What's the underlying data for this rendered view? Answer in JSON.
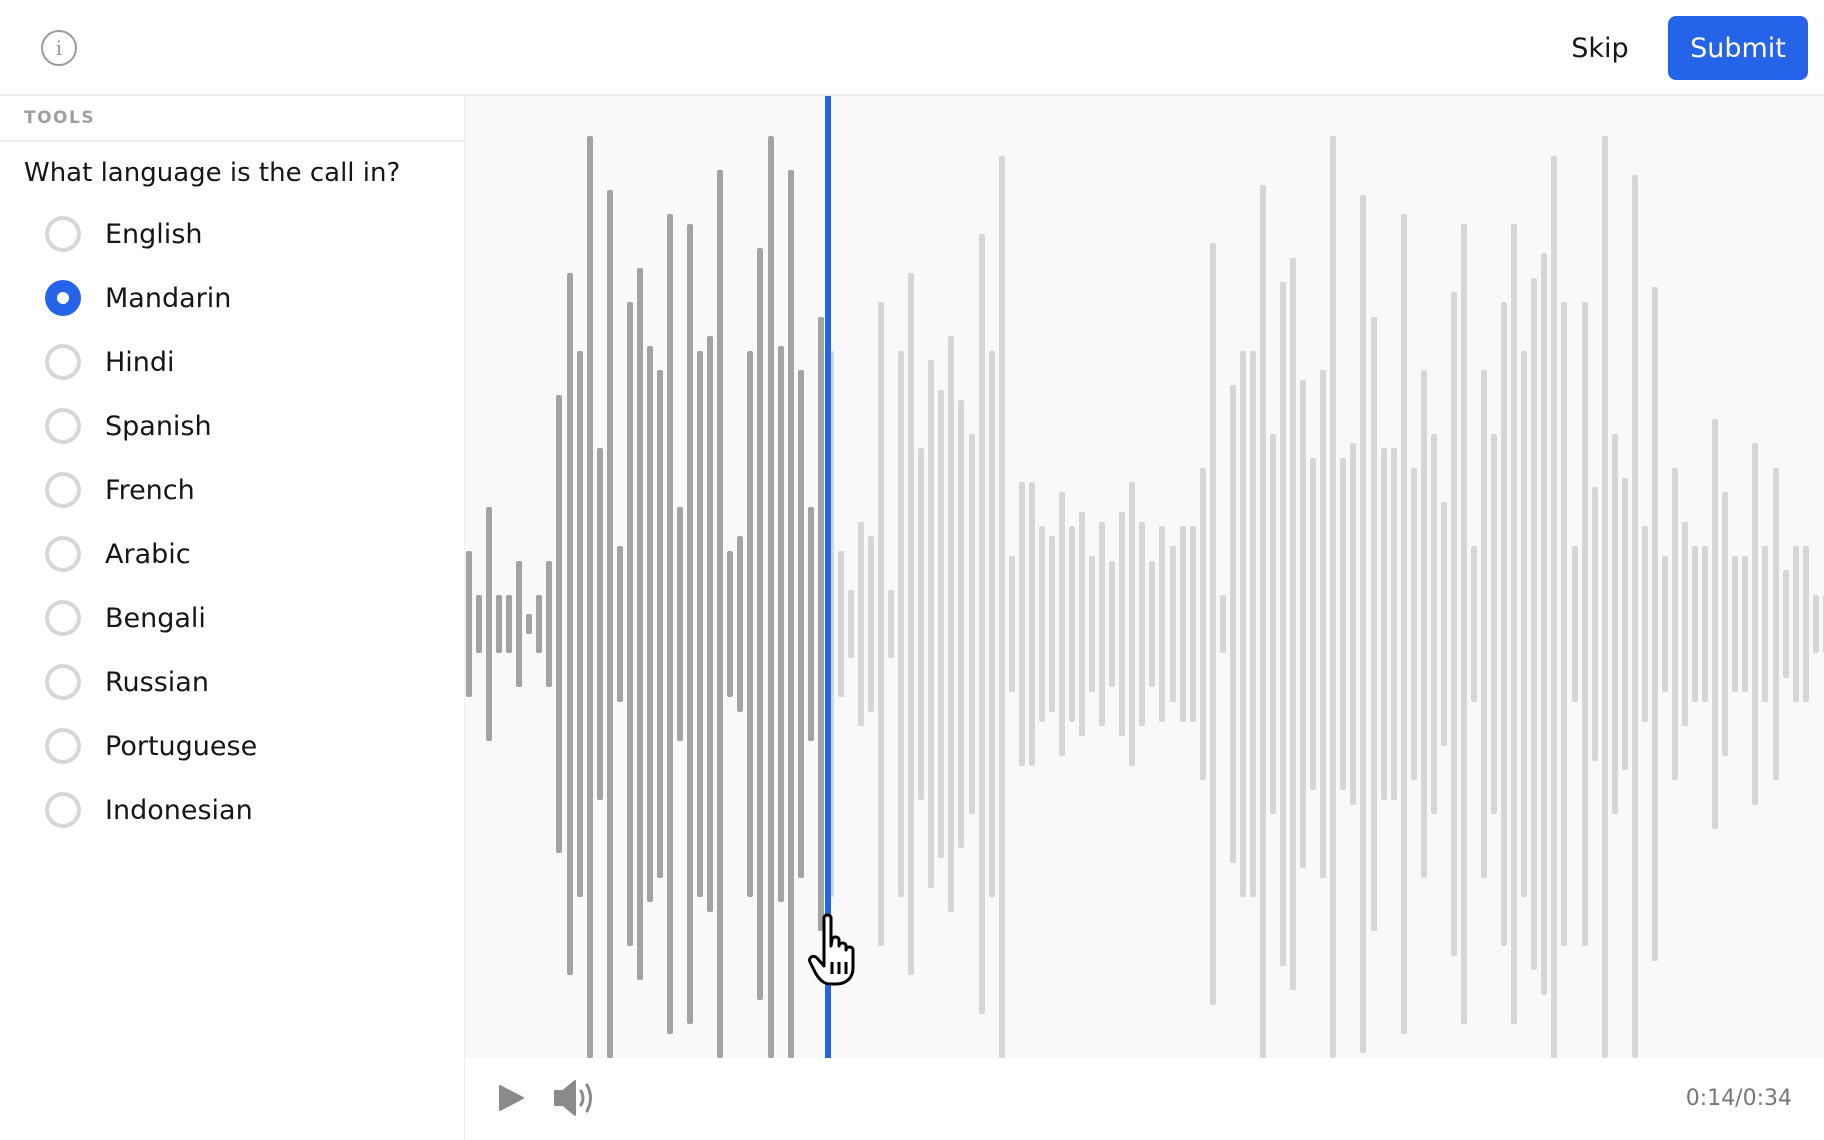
{
  "header": {
    "info_icon": "info-icon",
    "skip_label": "Skip",
    "submit_label": "Submit"
  },
  "sidebar": {
    "section_title": "TOOLS",
    "question": "What language is the call in?",
    "options": [
      {
        "label": "English",
        "selected": false
      },
      {
        "label": "Mandarin",
        "selected": true
      },
      {
        "label": "Hindi",
        "selected": false
      },
      {
        "label": "Spanish",
        "selected": false
      },
      {
        "label": "French",
        "selected": false
      },
      {
        "label": "Arabic",
        "selected": false
      },
      {
        "label": "Bengali",
        "selected": false
      },
      {
        "label": "Russian",
        "selected": false
      },
      {
        "label": "Portuguese",
        "selected": false
      },
      {
        "label": "Indonesian",
        "selected": false
      }
    ]
  },
  "player": {
    "current_time": "0:14",
    "duration": "0:34",
    "time_display": "0:14/0:34",
    "progress_fraction": 0.41,
    "play_icon": "play-icon",
    "volume_icon": "volume-icon"
  },
  "waveform": {
    "amplitudes": [
      0.15,
      0.06,
      0.24,
      0.06,
      0.06,
      0.13,
      0.02,
      0.06,
      0.13,
      0.47,
      0.72,
      0.56,
      1.0,
      0.36,
      0.89,
      0.16,
      0.66,
      0.73,
      0.57,
      0.52,
      0.84,
      0.24,
      0.82,
      0.56,
      0.59,
      0.93,
      0.15,
      0.18,
      0.56,
      0.77,
      1.0,
      0.57,
      0.93,
      0.52,
      0.24,
      0.63,
      0.56,
      0.15,
      0.07,
      0.21,
      0.18,
      0.66,
      0.07,
      0.56,
      0.72,
      0.36,
      0.54,
      0.48,
      0.59,
      0.46,
      0.39,
      0.8,
      0.56,
      0.96,
      0.14,
      0.29,
      0.29,
      0.2,
      0.18,
      0.27,
      0.2,
      0.23,
      0.14,
      0.21,
      0.13,
      0.23,
      0.29,
      0.21,
      0.13,
      0.2,
      0.16,
      0.2,
      0.2,
      0.32,
      0.78,
      0.06,
      0.49,
      0.56,
      0.56,
      0.9,
      0.39,
      0.7,
      0.75,
      0.5,
      0.34,
      0.52,
      1.0,
      0.34,
      0.37,
      0.88,
      0.63,
      0.36,
      0.36,
      0.84,
      0.32,
      0.52,
      0.39,
      0.25,
      0.68,
      0.82,
      0.16,
      0.52,
      0.39,
      0.66,
      0.82,
      0.56,
      0.71,
      0.76,
      0.96,
      0.66,
      0.16,
      0.66,
      0.28,
      1.0,
      0.39,
      0.3,
      0.92,
      0.2,
      0.69,
      0.14,
      0.32,
      0.21,
      0.16,
      0.16,
      0.42,
      0.27,
      0.14,
      0.14,
      0.37,
      0.16,
      0.32,
      0.11,
      0.16,
      0.16,
      0.06,
      0.06,
      0.39
    ],
    "played_count": 36,
    "played_color": "#a3a3a3",
    "unplayed_color": "#d6d6d6",
    "playhead_color": "#2563e8"
  },
  "colors": {
    "accent": "#2563e8"
  }
}
